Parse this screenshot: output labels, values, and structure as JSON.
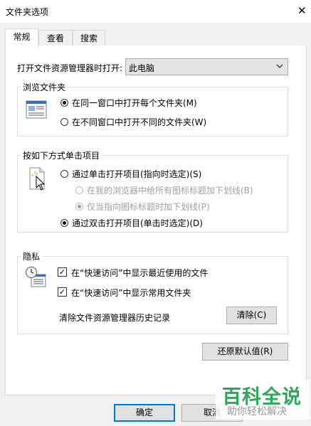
{
  "window": {
    "title": "文件夹选项",
    "close_glyph": "✕"
  },
  "tabs": [
    {
      "label": "常规",
      "active": true
    },
    {
      "label": "查看",
      "active": false
    },
    {
      "label": "搜索",
      "active": false
    }
  ],
  "open_explorer": {
    "label": "打开文件资源管理器时打开:",
    "value": "此电脑"
  },
  "browse_folders": {
    "legend": "浏览文件夹",
    "options": [
      {
        "label": "在同一窗口中打开每个文件夹(M)",
        "checked": true
      },
      {
        "label": "在不同窗口中打开不同的文件夹(W)",
        "checked": false
      }
    ]
  },
  "click_items": {
    "legend": "按如下方式单击项目",
    "options": [
      {
        "label": "通过单击打开项目(指向时选定)(S)",
        "checked": false
      },
      {
        "label": "在我的浏览器中给所有图标标题加下划线(B)",
        "checked": false,
        "disabled": true
      },
      {
        "label": "仅当指向图标标题时加下划线(P)",
        "checked": true,
        "disabled": true
      },
      {
        "label": "通过双击打开项目(单击时选定)(D)",
        "checked": true
      }
    ]
  },
  "privacy": {
    "legend": "隐私",
    "checks": [
      {
        "label": "在“快速访问”中显示最近使用的文件",
        "checked": true
      },
      {
        "label": "在“快速访问”中显示常用文件夹",
        "checked": true
      }
    ],
    "clear_label": "清除文件资源管理器历史记录",
    "clear_button": "清除(C)",
    "check_mark": "✓"
  },
  "restore_defaults": "还原默认值(R)",
  "footer": {
    "ok": "确定",
    "cancel": "取消"
  },
  "watermark": {
    "main": "百科全说",
    "sub": "助你轻松解决"
  },
  "colors": {
    "accent": "#0078d7",
    "watermark_green": "#2ca85a"
  }
}
